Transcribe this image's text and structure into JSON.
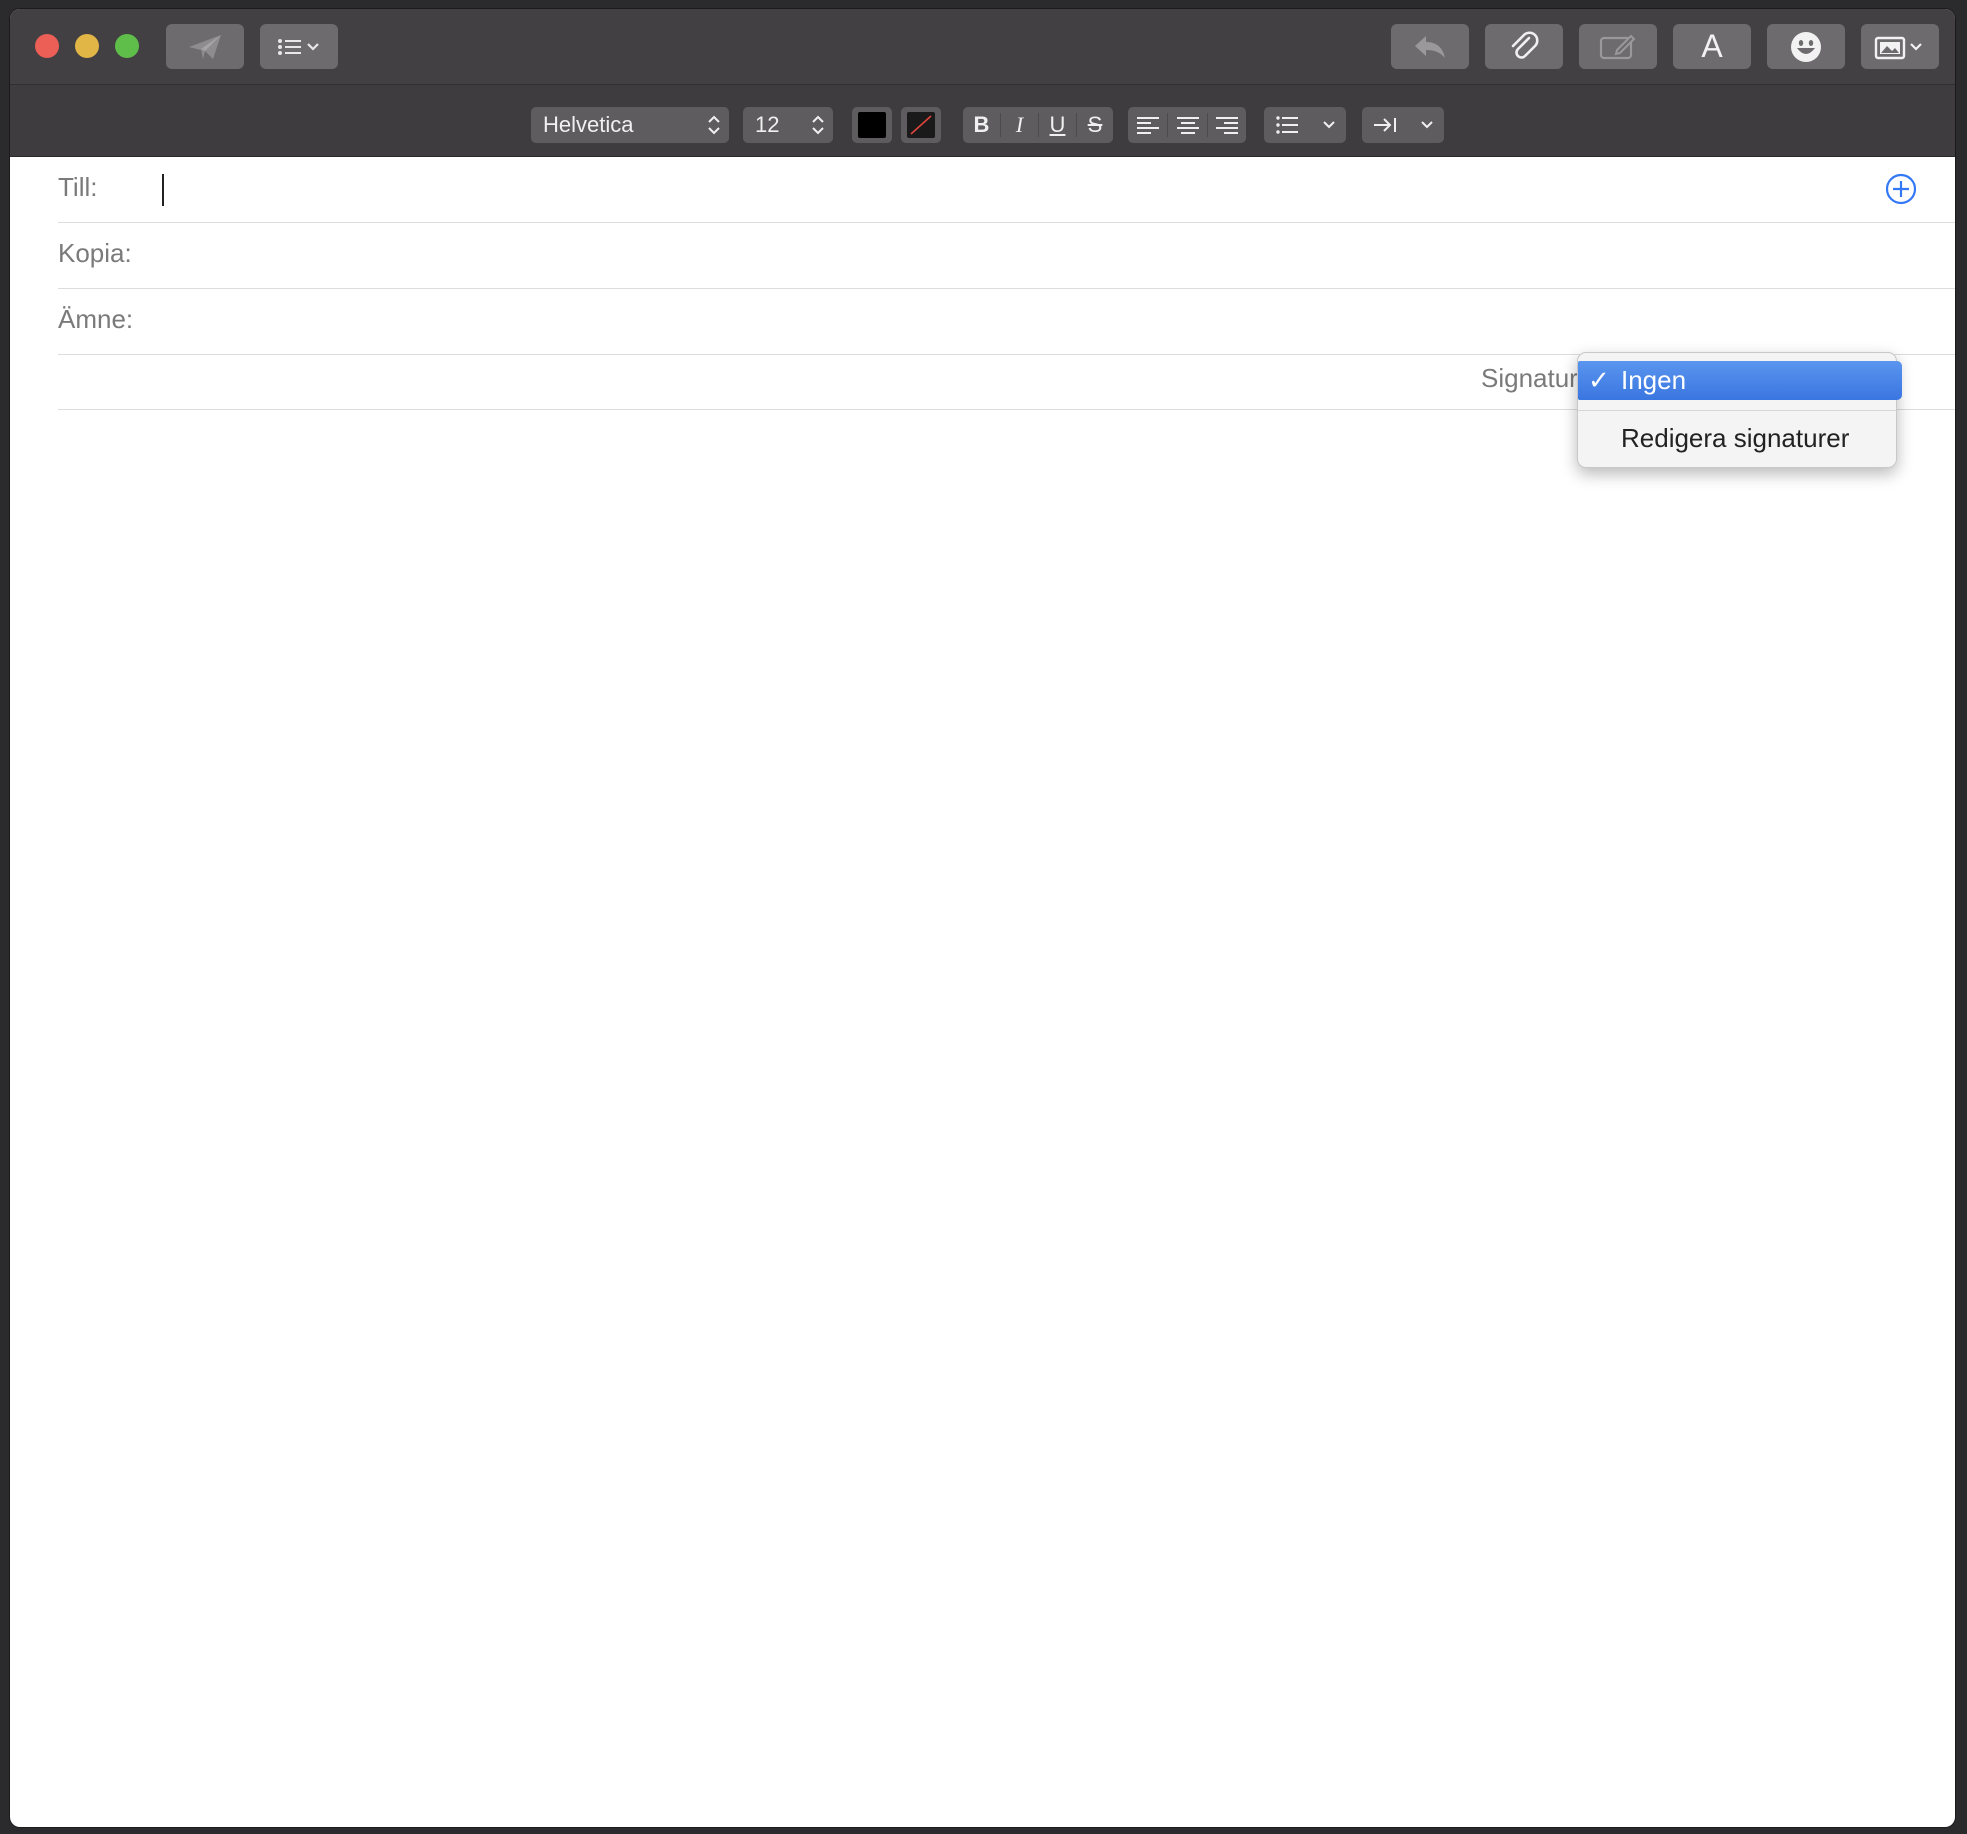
{
  "toolbar": {
    "send_icon": "paper-plane-icon",
    "header_fields_icon": "list-dropdown-icon",
    "reply_icon": "reply-arrow-icon",
    "attach_icon": "paperclip-icon",
    "markup_icon": "markup-icon",
    "font_button_label": "A",
    "emoji_icon": "smiley-icon",
    "photo_icon": "photo-browser-icon"
  },
  "format": {
    "font_family": "Helvetica",
    "font_size": "12",
    "bold": "B",
    "italic": "I",
    "underline": "U",
    "strikethrough": "S",
    "text_color": "#000000",
    "accent_color": "#3478f6"
  },
  "compose": {
    "to_label": "Till:",
    "to_value": "",
    "cc_label": "Kopia:",
    "cc_value": "",
    "subject_label": "Ämne:",
    "subject_value": "",
    "signature_label": "Signatur"
  },
  "signature_menu": {
    "check_mark": "✓",
    "selected": "Ingen",
    "items": [
      "Ingen",
      "Redigera signaturer"
    ]
  }
}
